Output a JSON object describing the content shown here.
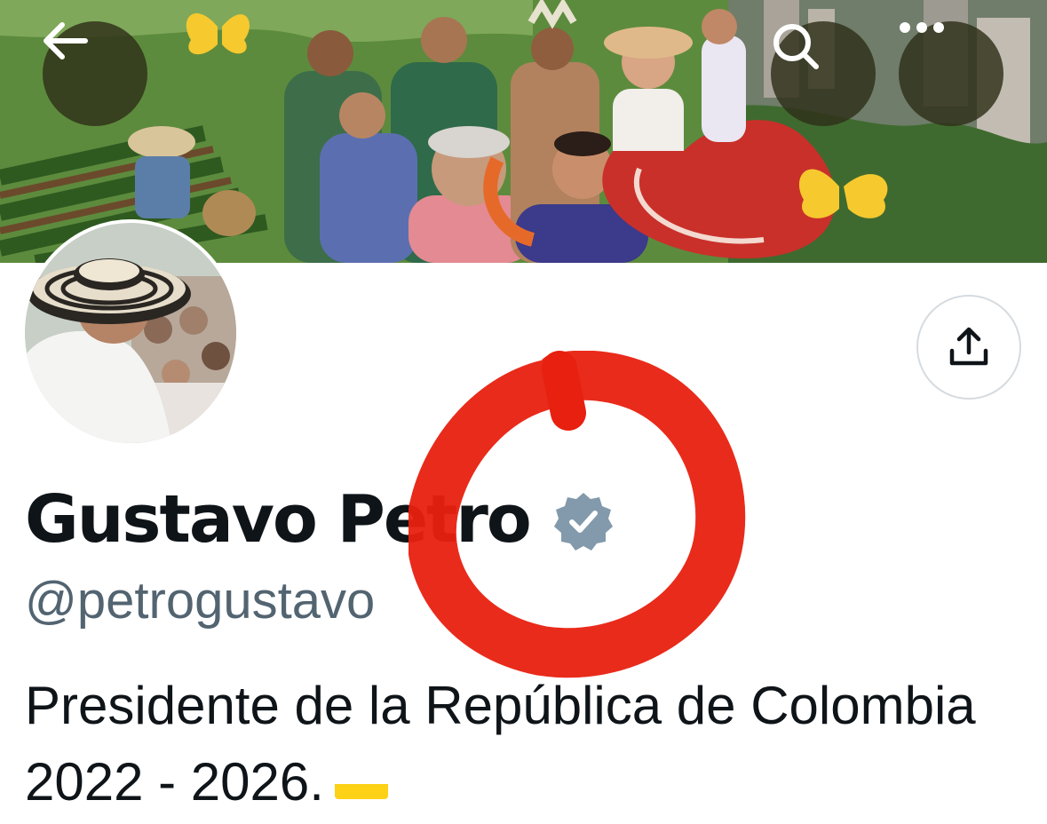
{
  "profile": {
    "display_name": "Gustavo Petro",
    "handle": "@petrogustavo",
    "bio_line1": "Presidente de la República de Colombia",
    "bio_line2": "2022 - 2026.",
    "verified": true,
    "verified_badge_color": "#829aab"
  },
  "header": {
    "back_icon": "arrow-left-icon",
    "search_icon": "search-icon",
    "more_icon": "ellipsis-icon"
  },
  "actions": {
    "share_icon": "share-icon"
  },
  "annotation": {
    "color": "#e8200f",
    "shape": "hand-drawn circle around verified badge"
  },
  "colors": {
    "text_primary": "#0f1419",
    "text_secondary": "#536471",
    "button_border": "#d6dbdf"
  }
}
